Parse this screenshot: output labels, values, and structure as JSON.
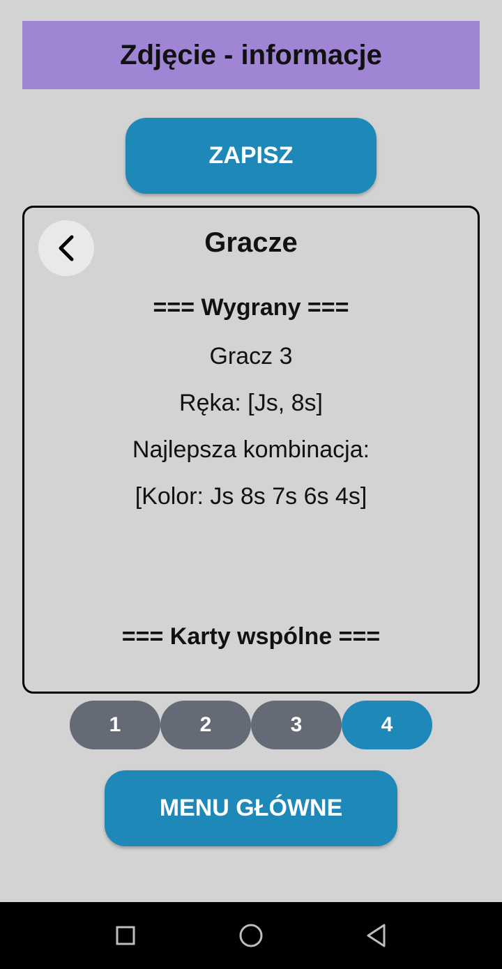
{
  "header": {
    "title": "Zdjęcie - informacje"
  },
  "toolbar": {
    "save_label": "ZAPISZ"
  },
  "card": {
    "title": "Gracze",
    "back_icon": "chevron-left-icon",
    "winner_heading": "=== Wygrany ===",
    "player_name": "Gracz 3",
    "hand": "Ręka: [Js, 8s]",
    "best_combo_label": "Najlepsza kombinacja:",
    "best_combo_value": "[Kolor: Js 8s 7s 6s 4s]",
    "community_heading": "=== Karty wspólne ==="
  },
  "pager": {
    "pages": [
      "1",
      "2",
      "3",
      "4"
    ],
    "active": "4"
  },
  "footer": {
    "menu_label": "MENU GŁÓWNE"
  },
  "navbar": {
    "icons": [
      "square-recents-icon",
      "circle-home-icon",
      "triangle-back-icon"
    ]
  },
  "colors": {
    "background": "#d3d3d3",
    "header": "#a085d4",
    "accent": "#1e88b8",
    "inactive_page": "#656a77"
  }
}
